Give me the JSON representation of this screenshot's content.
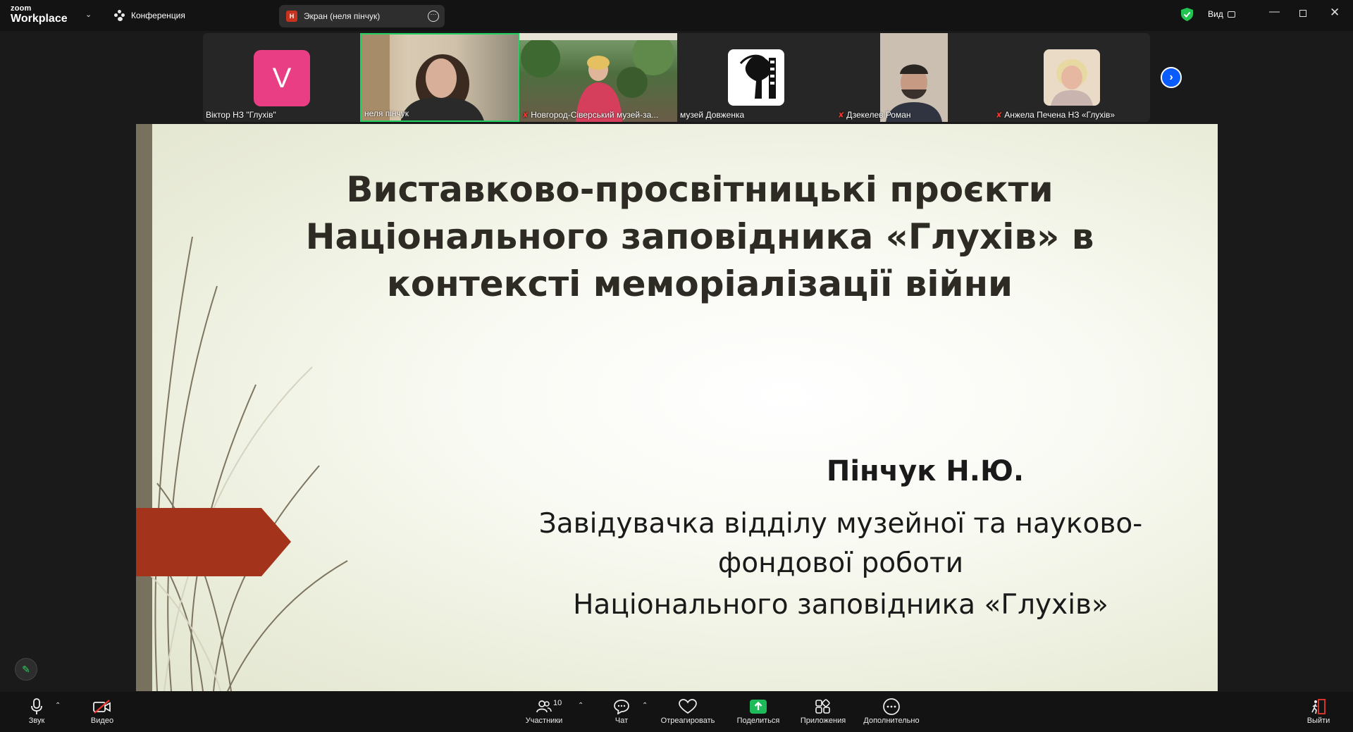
{
  "app": {
    "brand_top": "zoom",
    "brand_bottom": "Workplace"
  },
  "header": {
    "conference_label": "Конференция",
    "screen_tab": {
      "badge": "Н",
      "label": "Экран (неля пінчук)"
    },
    "view_label": "Вид"
  },
  "participants": [
    {
      "name": "Віктор НЗ \"Глухів\"",
      "avatar_letter": "V",
      "muted": false
    },
    {
      "name": "неля пінчук",
      "muted": false,
      "active_speaker": true
    },
    {
      "name": "Новгород-Сіверський музей-за...",
      "muted": true
    },
    {
      "name": "музей Довженка",
      "muted": false
    },
    {
      "name": "Дзекелев Роман",
      "muted": true
    },
    {
      "name": "Анжела Печена НЗ «Глухів»",
      "muted": true
    }
  ],
  "slide": {
    "title_lines": [
      "Виставково-просвітницькі проєкти",
      "Національного заповідника «Глухів» в",
      "контексті меморіалізації війни"
    ],
    "author": "Пінчук Н.Ю.",
    "position_lines": [
      "Завідувачка відділу музейної та науково-",
      "фондової роботи"
    ],
    "institution": "Національного заповідника «Глухів»"
  },
  "toolbar": {
    "audio": "Звук",
    "video": "Видео",
    "participants": "Участники",
    "participants_count": "10",
    "chat": "Чат",
    "react": "Отреагировать",
    "share": "Поделиться",
    "apps": "Приложения",
    "more": "Дополнительно",
    "leave": "Выйти"
  },
  "colors": {
    "accent_blue": "#0b5cff",
    "share_green": "#1dbb5a",
    "active_speaker_border": "#23d160",
    "slide_arrow": "#a4331c",
    "slide_bar": "#78715e",
    "avatar_pink": "#ea3e84"
  }
}
